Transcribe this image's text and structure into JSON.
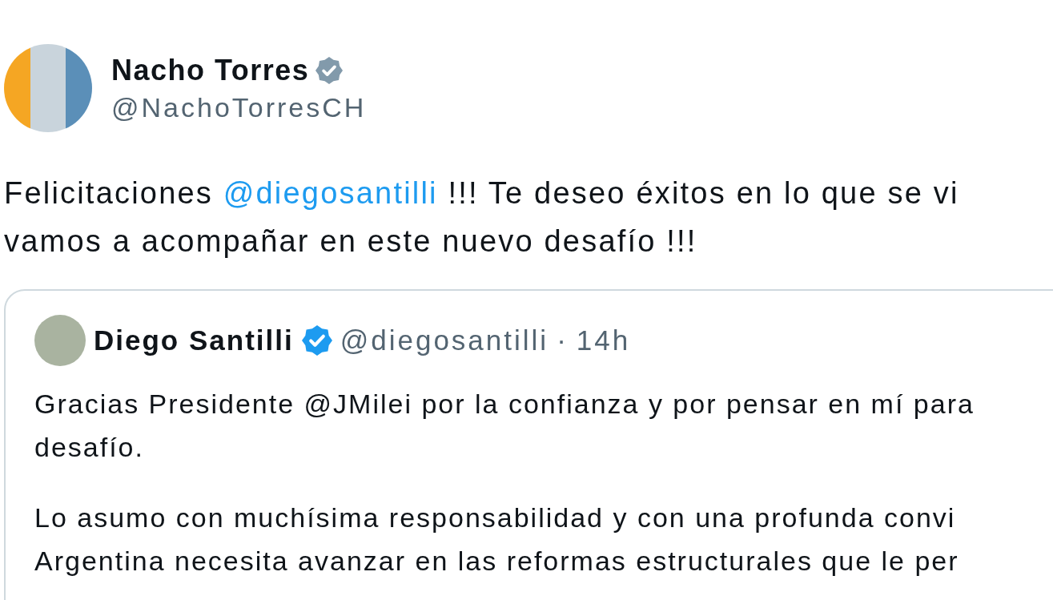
{
  "author": {
    "name": "Nacho Torres",
    "verified": true,
    "handle": "@NachoTorresCH"
  },
  "text_lines": [
    [
      {
        "kind": "text",
        "text": "Felicitaciones "
      },
      {
        "kind": "mention",
        "text": "@diegosantilli"
      },
      {
        "kind": "text",
        "text": " !!! Te deseo éxitos en lo que se vi"
      }
    ],
    [
      {
        "kind": "text",
        "text": "vamos a acompañar en este nuevo desafío !!!"
      }
    ]
  ],
  "quote": {
    "author": {
      "name": "Diego Santilli",
      "verified": true,
      "handle": "@diegosantilli",
      "separator": "·",
      "time": "14h"
    },
    "paragraphs": [
      [
        "Gracias Presidente @JMilei por la confianza y por pensar en mí para",
        "desafío."
      ],
      [
        "Lo asumo con muchísima responsabilidad y con una profunda convi",
        "Argentina necesita avanzar en las reformas estructurales que le per"
      ]
    ]
  }
}
